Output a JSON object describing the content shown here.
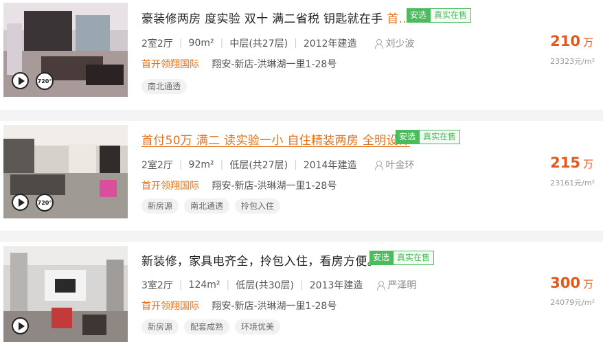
{
  "listings": [
    {
      "title": "豪装修两房 度实验 双十 满二省税 钥匙就在手 ",
      "title_hl": "首…",
      "badge_primary": "安选",
      "badge_secondary": "真实在售",
      "layout": "2室2厅",
      "area": "90m²",
      "floor": "中层(共27层)",
      "built": "2012年建造",
      "agent": "刘少波",
      "community": "首开领翔国际",
      "location": "翔安-新店-洪琳湖一里1-28号",
      "features": [
        "南北通透"
      ],
      "price": "210",
      "price_unit": "万",
      "unit_price": "23323元/m²",
      "pano_label": "720°",
      "photo_colors": [
        "#d9d3d8",
        "#2e2a2c"
      ]
    },
    {
      "title": "首付50万 满二 读实验一小 自住精装两房 全明设计",
      "badge_primary": "安选",
      "badge_secondary": "真实在售",
      "layout": "2室2厅",
      "area": "92m²",
      "floor": "低层(共27层)",
      "built": "2014年建造",
      "agent": "叶金环",
      "community": "首开领翔国际",
      "location": "翔安-新店-洪琳湖一里1-28号",
      "features": [
        "新房源",
        "南北通透",
        "拎包入住"
      ],
      "price": "215",
      "price_unit": "万",
      "unit_price": "23161元/m²",
      "pano_label": "720°",
      "photo_colors": [
        "#e6e2dc",
        "#3a3735"
      ]
    },
    {
      "title": "新装修，家具电齐全，拎包入住，看房方便。",
      "badge_primary": "安选",
      "badge_secondary": "真实在售",
      "layout": "3室2厅",
      "area": "124m²",
      "floor": "低层(共30层)",
      "built": "2013年建造",
      "agent": "严泽明",
      "community": "首开领翔国际",
      "location": "翔安-新店-洪琳湖一里1-28号",
      "features": [
        "新房源",
        "配套成熟",
        "环境优美"
      ],
      "price": "300",
      "price_unit": "万",
      "unit_price": "24079元/m²",
      "photo_colors": [
        "#dcdad8",
        "#5a5453"
      ]
    }
  ]
}
